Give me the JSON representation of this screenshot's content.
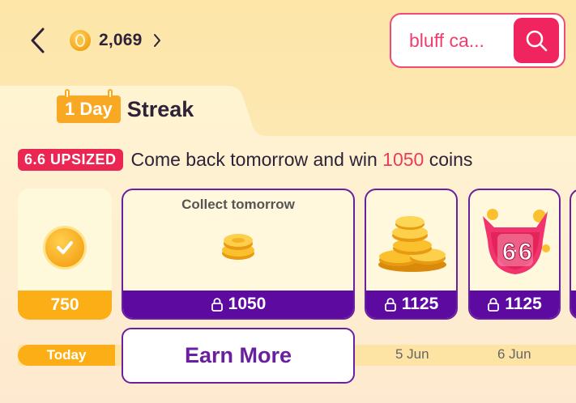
{
  "header": {
    "coin_balance": "2,069",
    "search_text": "bluff ca..."
  },
  "streak": {
    "day_badge": "1 Day",
    "title": "Streak"
  },
  "promo": {
    "badge": "6.6 UPSIZED",
    "text_before": "Come back tomorrow and win ",
    "amount": "1050",
    "text_after": " coins"
  },
  "cards": [
    {
      "value": "750",
      "state": "collected"
    },
    {
      "value": "1050",
      "state": "locked",
      "label": "Collect tomorrow"
    },
    {
      "value": "1125",
      "state": "locked"
    },
    {
      "value": "1125",
      "state": "locked"
    }
  ],
  "timeline": {
    "today": "Today",
    "date_1": "5 Jun",
    "date_2": "6 Jun"
  },
  "earn_more": "Earn More",
  "colors": {
    "accent_pink": "#f0245e",
    "purple": "#5d0aa0",
    "orange": "#fbae16"
  }
}
